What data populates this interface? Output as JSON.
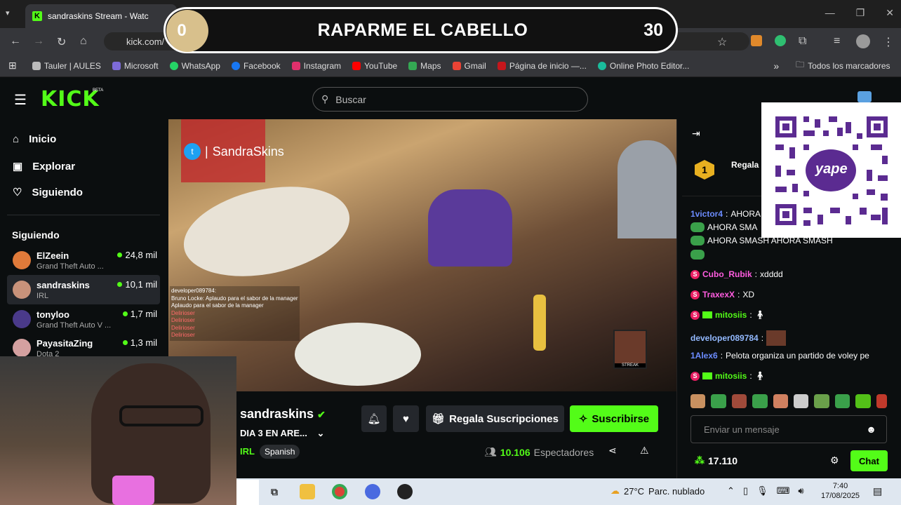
{
  "browser": {
    "tab_title": "sandraskins Stream - Watc",
    "url": "kick.com/",
    "url_tail": "ins",
    "bookmarks": [
      "Tauler | AULES",
      "Microsoft",
      "WhatsApp",
      "Facebook",
      "Instagram",
      "YouTube",
      "Maps",
      "Gmail",
      "Página de inicio —...",
      "Online Photo Editor..."
    ],
    "all_bookmarks": "Todos los marcadores"
  },
  "overlay": {
    "left_value": "0",
    "title": "RAPARME EL CABELLO",
    "right_value": "30"
  },
  "kick": {
    "logo": "KICK",
    "beta": "BETA",
    "search_placeholder": "Buscar"
  },
  "sidebar": {
    "nav": [
      {
        "label": "Inicio",
        "icon": "home-icon"
      },
      {
        "label": "Explorar",
        "icon": "compass-icon"
      },
      {
        "label": "Siguiendo",
        "icon": "heart-icon"
      }
    ],
    "following_header": "Siguiendo",
    "channels": [
      {
        "name": "ElZeein",
        "game": "Grand Theft Auto ...",
        "viewers": "24,8 mil",
        "color": "#e07a3a"
      },
      {
        "name": "sandraskins",
        "game": "IRL",
        "viewers": "10,1 mil",
        "color": "#c8927a"
      },
      {
        "name": "tonyloo",
        "game": "Grand Theft Auto V ...",
        "viewers": "1,7 mil",
        "color": "#4a3a8a"
      },
      {
        "name": "PayasitaZing",
        "game": "Dota 2",
        "viewers": "1,3 mil",
        "color": "#d4a0a0"
      }
    ]
  },
  "video": {
    "twitter_handle": "SandraSkins",
    "overlay_chat": [
      "developer089784:",
      "Bruno Locke: Aplaudo para el sabor de la manager",
      "Aplaudo para el sabor de la manager",
      "Delirioser",
      "Delirioser",
      "Delirioser",
      "Delirioser"
    ],
    "streak_label": "STREAK"
  },
  "stream": {
    "streamer": "sandraskins",
    "title": "DIA 3 EN ARE...",
    "category": "IRL",
    "language": "Spanish",
    "gift_label": "Regala Suscripciones",
    "subscribe_label": "Suscribirse",
    "viewers": "10.106",
    "viewers_label": "Espectadores"
  },
  "chat": {
    "pinned_rank": "1",
    "pinned_label": "Regala",
    "messages": [
      {
        "user": "1victor4",
        "text": "AHORA",
        "color": "#6c8cff",
        "badge": false
      },
      {
        "user": "",
        "text": "AHORA SMA",
        "color": "#fff",
        "badge": false
      },
      {
        "user": "",
        "text": "AHORA SMASH    AHORA SMASH",
        "color": "#fff",
        "badge": false
      },
      {
        "user": "Cubo_Rubik",
        "text": "xdddd",
        "color": "#ff5ce0",
        "badge": true
      },
      {
        "user": "TraxexX",
        "text": "XD",
        "color": "#ff5ce0",
        "badge": true
      },
      {
        "user": "mitosiis",
        "text": "",
        "color": "#53fc18",
        "badge": true
      },
      {
        "user": "developer089784",
        "text": "",
        "color": "#93b9ff",
        "badge": false
      },
      {
        "user": "1Alex6",
        "text": "Pelota organiza un partido de voley pe",
        "color": "#6c8cff",
        "badge": false
      },
      {
        "user": "mitosiis",
        "text": "",
        "color": "#53fc18",
        "badge": true
      }
    ],
    "input_placeholder": "Enviar un mensaje",
    "points": "17.110",
    "chat_button": "Chat",
    "qr_label": "yape"
  },
  "taskbar": {
    "temperature": "27°C",
    "weather": "Parc. nublado",
    "time": "7:40",
    "date": "17/08/2025"
  },
  "colors": {
    "kick_green": "#53fc18",
    "background": "#0b0e0f"
  }
}
